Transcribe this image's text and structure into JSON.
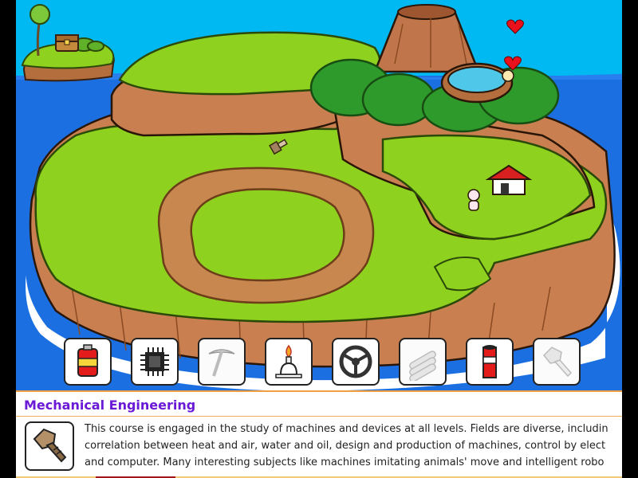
{
  "colors": {
    "sea": "#1b6fe0",
    "sky": "#00b9f2",
    "grass": "#8fd11f",
    "cliff": "#c97f4f",
    "dirt_track": "#c7874f",
    "title_purple": "#6a19d6",
    "panel_border": "#f0a040"
  },
  "hearts": [
    "heart-icon",
    "heart-icon"
  ],
  "items": [
    {
      "name": "oil-can-icon",
      "state": "active"
    },
    {
      "name": "microchip-icon",
      "state": "active"
    },
    {
      "name": "pickaxe-icon",
      "state": "locked"
    },
    {
      "name": "alcohol-burner-icon",
      "state": "active"
    },
    {
      "name": "steering-wheel-icon",
      "state": "active"
    },
    {
      "name": "logs-icon",
      "state": "locked"
    },
    {
      "name": "chimney-icon",
      "state": "active"
    },
    {
      "name": "bolt-icon",
      "state": "locked"
    }
  ],
  "info": {
    "title": "Mechanical Engineering",
    "icon": "bolt-icon",
    "lines": [
      "This course is engaged in the study of machines and devices at all levels. Fields are diverse, includin",
      "correlation between heat and air, water and oil, design and production of machines, control by elect",
      "and computer. Many interesting subjects like machines imitating animals' move and intelligent robo"
    ]
  }
}
